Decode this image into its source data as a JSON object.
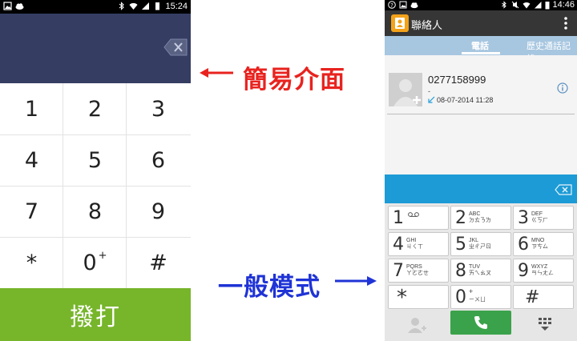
{
  "colors": {
    "simple_display_bg": "#353d63",
    "simple_call_bg": "#77b52b",
    "annot_red": "#e8231f",
    "annot_blue": "#1f33d6",
    "general_tab_bg": "#a7c6e0",
    "general_dial_bg": "#1c9bd6",
    "general_call_bg": "#3aa24a",
    "app_icon": "#f3a21a"
  },
  "left_phone": {
    "status_time": "15:24",
    "keys": [
      "1",
      "2",
      "3",
      "4",
      "5",
      "6",
      "7",
      "8",
      "9",
      "*",
      "0",
      "#"
    ],
    "zero_sup": "+",
    "call_label": "撥打",
    "icons": [
      "image-icon",
      "cloud-icon",
      "bluetooth-icon",
      "wifi-icon",
      "signal-icon",
      "battery-icon",
      "backspace-icon"
    ]
  },
  "annotations": {
    "simple": "簡易介面",
    "general": "一般模式"
  },
  "right_phone": {
    "status_time": "14:46",
    "title": "聯絡人",
    "tabs": [
      "電話",
      "歷史通話記錄"
    ],
    "log": {
      "number": "0277158999",
      "sub": "-",
      "datetime": "08-07-2014  11:28"
    },
    "keys": [
      {
        "digit": "1",
        "l1": "",
        "l2": ""
      },
      {
        "digit": "2",
        "l1": "ABC",
        "l2": "ㄉㄊㄋㄌ"
      },
      {
        "digit": "3",
        "l1": "DEF",
        "l2": "ㄍㄎㄏ"
      },
      {
        "digit": "4",
        "l1": "GHI",
        "l2": "ㄐㄑㄒ"
      },
      {
        "digit": "5",
        "l1": "JKL",
        "l2": "ㄓㄔㄕㄖ"
      },
      {
        "digit": "6",
        "l1": "MNO",
        "l2": "ㄗㄘㄙ"
      },
      {
        "digit": "7",
        "l1": "PQRS",
        "l2": "ㄚㄛㄜㄝ"
      },
      {
        "digit": "8",
        "l1": "TUV",
        "l2": "ㄞㄟㄠㄡ"
      },
      {
        "digit": "9",
        "l1": "WXYZ",
        "l2": "ㄢㄣㄤㄥ"
      },
      {
        "digit": "*",
        "l1": "",
        "l2": ""
      },
      {
        "digit": "0",
        "l1": "+",
        "l2": "ㄧㄨㄩ"
      },
      {
        "digit": "#",
        "l1": "",
        "l2": ""
      }
    ]
  }
}
